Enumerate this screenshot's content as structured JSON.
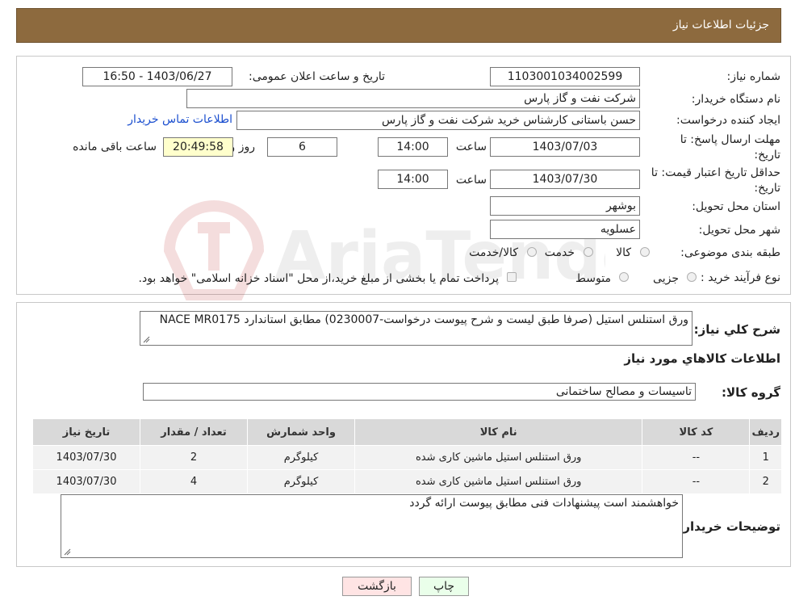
{
  "header": {
    "title": "جزئیات اطلاعات نیاز"
  },
  "form": {
    "need_number_label": "شماره نیاز:",
    "need_number": "1103001034002599",
    "announce_label": "تاریخ و ساعت اعلان عمومی:",
    "announce_value": "1403/06/27 - 16:50",
    "buyer_org_label": "نام دستگاه خریدار:",
    "buyer_org": "شرکت نفت و گاز پارس",
    "creator_label": "ایجاد کننده درخواست:",
    "creator": "حسن باستانی کارشناس خرید شرکت نفت و گاز پارس",
    "contact_link": "اطلاعات تماس خریدار",
    "reply_deadline_label_1": "مهلت ارسال پاسخ: تا",
    "reply_deadline_label_2": "تاریخ:",
    "reply_date": "1403/07/03",
    "time_label": "ساعت",
    "reply_time": "14:00",
    "days_value": "6",
    "days_label": "روز و",
    "remaining_time": "20:49:58",
    "remaining_label": "ساعت باقی مانده",
    "price_validity_label_1": "حداقل تاریخ اعتبار قیمت: تا",
    "price_validity_label_2": "تاریخ:",
    "price_validity_date": "1403/07/30",
    "price_validity_time": "14:00",
    "province_label": "استان محل تحویل:",
    "province": "بوشهر",
    "city_label": "شهر محل تحویل:",
    "city": "عسلویه",
    "category_label": "طبقه بندی موضوعی:",
    "category_options": [
      "کالا",
      "خدمت",
      "کالا/خدمت"
    ],
    "process_label": "نوع فرآیند خرید :",
    "process_options": [
      "جزیی",
      "متوسط"
    ],
    "process_note": "پرداخت تمام یا بخشی از مبلغ خرید،از محل \"اسناد خزانه اسلامی\" خواهد بود."
  },
  "details": {
    "desc_label": "شرح کلي نياز:",
    "desc_text": "ورق استنلس استیل  (صرفا طبق لیست و شرح پیوست درخواست-0230007) مطابق استاندارد NACE MR0175",
    "items_title": "اطلاعات کالاهاي مورد نياز",
    "group_label": "گروه کالا:",
    "group_value": "تاسیسات و مصالح ساختمانی",
    "table": {
      "headers": [
        "رديف",
        "کد کالا",
        "نام کالا",
        "واحد شمارش",
        "تعداد / مقدار",
        "تاريخ نياز"
      ],
      "rows": [
        [
          "1",
          "--",
          "ورق استنلس استیل ماشین کاری شده",
          "کیلوگرم",
          "2",
          "1403/07/30"
        ],
        [
          "2",
          "--",
          "ورق استنلس استیل ماشین کاری شده",
          "کیلوگرم",
          "4",
          "1403/07/30"
        ]
      ]
    },
    "buyer_notes_label": "توضيحات خريدار:",
    "buyer_notes": "خواهشمند است پیشنهادات فنی مطابق پیوست ارائه گردد"
  },
  "buttons": {
    "print": "چاپ",
    "back": "بازگشت"
  },
  "watermark": {
    "text": "AriaTender.neT"
  },
  "colors": {
    "header_bg": "#8d6a3e",
    "print_bg": "#eaffea",
    "back_bg": "#ffe4e4",
    "link": "#1a4ecf"
  }
}
